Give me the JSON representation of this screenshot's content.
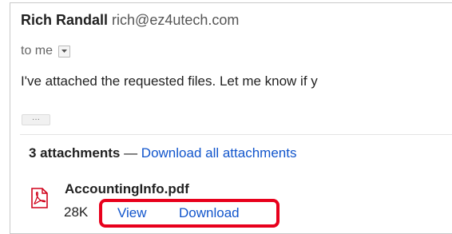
{
  "message": {
    "sender_name": "Rich Randall",
    "sender_email": "rich@ez4utech.com",
    "recipient_label": "to me",
    "body_preview": "I've attached the requested files. Let me know if y",
    "ellipsis": "···"
  },
  "attachments": {
    "count_label": "3 attachments",
    "separator": " — ",
    "download_all_label": "Download all attachments",
    "file": {
      "name": "AccountingInfo.pdf",
      "size": "28K",
      "view_label": "View",
      "download_label": "Download",
      "icon": "pdf-icon"
    }
  },
  "colors": {
    "link": "#1155cc",
    "highlight": "#e8001c",
    "pdf_icon": "#d0021b"
  }
}
